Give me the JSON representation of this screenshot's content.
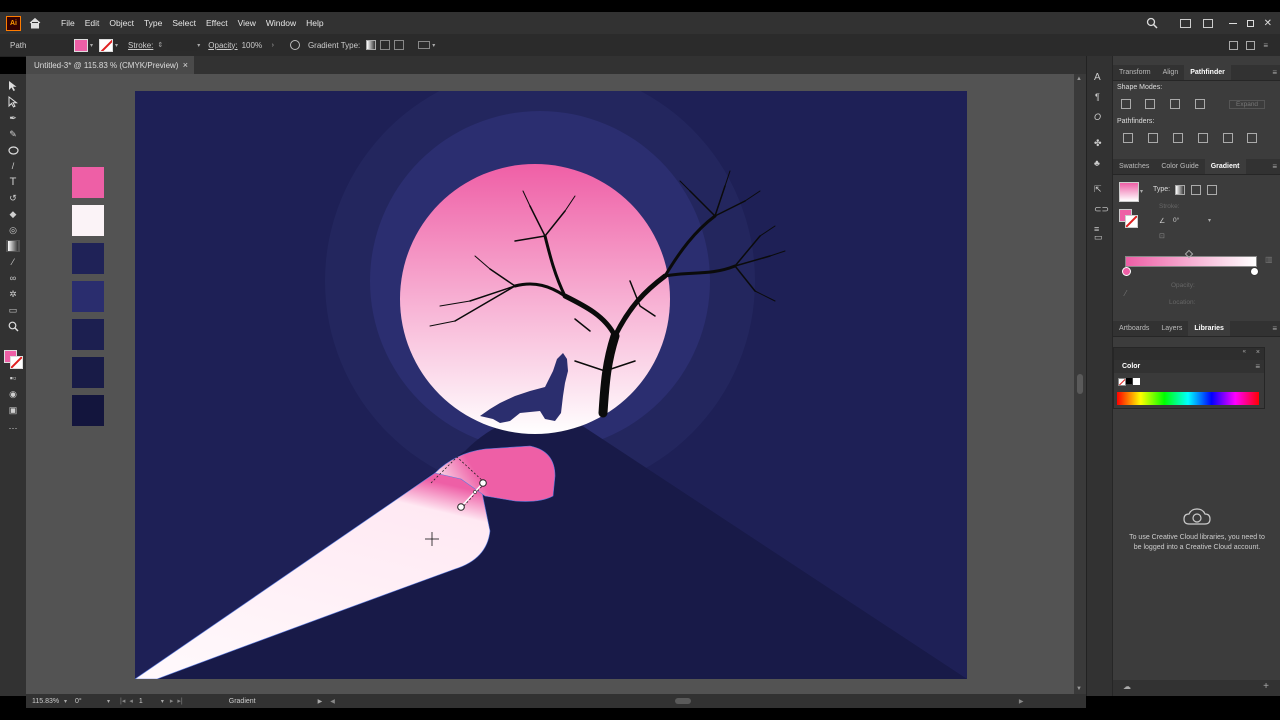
{
  "app": {
    "logo": "Ai"
  },
  "menu": {
    "items": [
      "File",
      "Edit",
      "Object",
      "Type",
      "Select",
      "Effect",
      "View",
      "Window",
      "Help"
    ]
  },
  "control_bar": {
    "selection_label": "Path",
    "stroke_label": "Stroke:",
    "opacity_label": "Opacity:",
    "opacity_value": "100%",
    "gradient_type_label": "Gradient Type:"
  },
  "document": {
    "tab_title": "Untitled-3* @ 115.83 % (CMYK/Preview)",
    "close_glyph": "×"
  },
  "swatches": [
    {
      "name": "pink",
      "color": "#ee5fa6"
    },
    {
      "name": "white",
      "color": "#fbf3f7"
    },
    {
      "name": "navy-1",
      "color": "#1f2257"
    },
    {
      "name": "navy-2",
      "color": "#2a2d6e"
    },
    {
      "name": "navy-3",
      "color": "#1c1f50"
    },
    {
      "name": "navy-4",
      "color": "#181b47"
    },
    {
      "name": "navy-5",
      "color": "#13153d"
    }
  ],
  "colors": {
    "artboard_bg": "#1e2056",
    "ring_outer": "#23265e",
    "ring_inner": "#2b2e70",
    "moon_top": "#ef5fa6",
    "moon_bottom": "#ffffff",
    "hill": "#181a48",
    "accent_pink": "#ee5fa6"
  },
  "panels": {
    "top_tabs": [
      "Transform",
      "Align",
      "Pathfinder"
    ],
    "shape_modes_label": "Shape Modes:",
    "expand_label": "Expand",
    "pathfinders_label": "Pathfinders:",
    "mid_tabs": [
      "Swatches",
      "Color Guide",
      "Gradient"
    ],
    "gradient": {
      "type_label": "Type:",
      "stroke_label": "Stroke:",
      "angle_value": "0°",
      "opacity_label": "Opacity:",
      "location_label": "Location:"
    },
    "bottom_tabs": [
      "Artboards",
      "Layers",
      "Libraries"
    ],
    "color_title": "Color",
    "libraries_message": "To use Creative Cloud libraries, you need to be logged into a Creative Cloud account."
  },
  "status": {
    "zoom": "115.83%",
    "angle": "0°",
    "artboard_number": "1",
    "tool_name": "Gradient"
  }
}
